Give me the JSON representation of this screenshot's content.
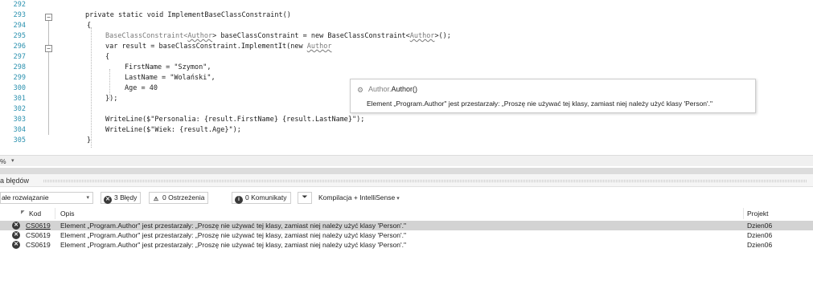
{
  "editor": {
    "lines": [
      {
        "num": "292",
        "code": ""
      },
      {
        "num": "293",
        "code": "private static void ImplementBaseClassConstraint()"
      },
      {
        "num": "294",
        "code": "{"
      },
      {
        "num": "295",
        "code_parts": [
          "BaseClassConstraint<",
          "Author",
          "> baseClassConstraint = new BaseClassConstraint<",
          "Author",
          ">();"
        ]
      },
      {
        "num": "296",
        "code_parts": [
          "var result = baseClassConstraint.ImplementIt(new ",
          "Author"
        ]
      },
      {
        "num": "297",
        "code": "{"
      },
      {
        "num": "298",
        "code": "FirstName = \"Szymon\","
      },
      {
        "num": "299",
        "code": "LastName = \"Wolański\","
      },
      {
        "num": "300",
        "code": "Age = 40"
      },
      {
        "num": "301",
        "code": "});"
      },
      {
        "num": "302",
        "code": ""
      },
      {
        "num": "303",
        "code": "WriteLine($\"Personalia: {result.FirstName} {result.LastName}\");"
      },
      {
        "num": "304",
        "code": "WriteLine($\"Wiek: {result.Age}\");"
      },
      {
        "num": "305",
        "code": "}"
      }
    ]
  },
  "tooltip": {
    "signature_ns": "Author.",
    "signature_name": "Author()",
    "message": "Element „Program.Author\" jest przestarzały: „Proszę nie używać tej klasy, zamiast niej należy użyć klasy 'Person'.\""
  },
  "zoom": {
    "value": "%"
  },
  "error_list": {
    "title": "a błędów",
    "scope": "ałe rozwiązanie",
    "errors_label": "3 Błędy",
    "warnings_label": "0 Ostrzeżenia",
    "messages_label": "0 Komunikaty",
    "build_filter": "Kompilacja + IntelliSense",
    "columns": {
      "code": "Kod",
      "description": "Opis",
      "project": "Projekt"
    },
    "rows": [
      {
        "code": "CS0619",
        "description": "Element „Program.Author\" jest przestarzały: „Proszę nie używać tej klasy, zamiast niej należy użyć klasy 'Person'.\"",
        "project": "Dzien06"
      },
      {
        "code": "CS0619",
        "description": "Element „Program.Author\" jest przestarzały: „Proszę nie używać tej klasy, zamiast niej należy użyć klasy 'Person'.\"",
        "project": "Dzien06"
      },
      {
        "code": "CS0619",
        "description": "Element „Program.Author\" jest przestarzały: „Proszę nie używać tej klasy, zamiast niej należy użyć klasy 'Person'.\"",
        "project": "Dzien06"
      }
    ]
  },
  "colors": {
    "line_number": "#2b91af",
    "selected_row": "#d3d3d3",
    "error_icon": "#3a3a3a"
  },
  "icons": {
    "collapse": "minus-box-icon",
    "error": "error-circle-icon",
    "warning": "warning-triangle-icon",
    "info": "info-circle-icon",
    "filter": "filter-icon",
    "method": "method-icon"
  }
}
